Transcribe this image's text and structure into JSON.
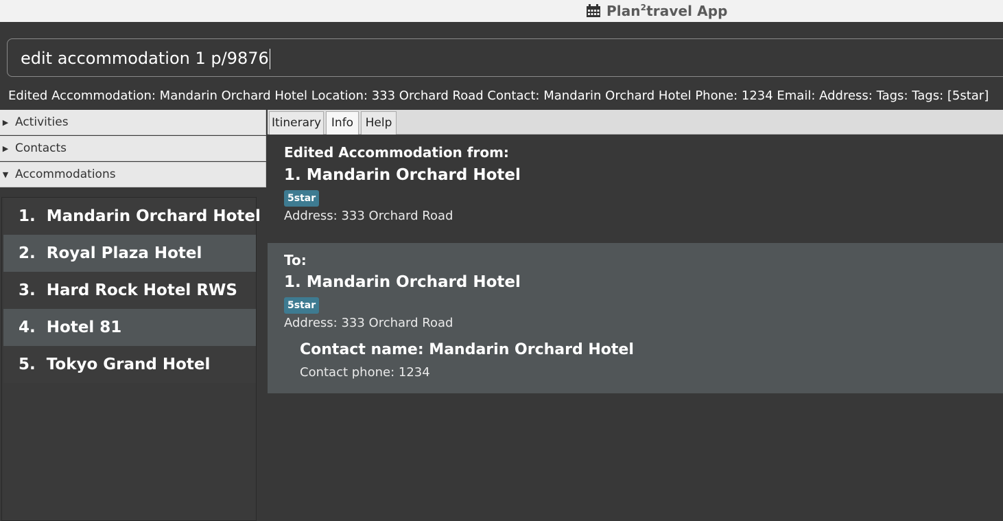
{
  "window": {
    "title_prefix": "Plan",
    "title_sup": "2",
    "title_suffix": "travel App"
  },
  "command": {
    "input_value": "edit accommodation 1 p/9876"
  },
  "result": {
    "text": "Edited Accommodation: Mandarin Orchard Hotel Location: 333 Orchard Road Contact: Mandarin Orchard Hotel Phone: 1234 Email:  Address:  Tags:  Tags: [5star]"
  },
  "sidebar": {
    "sections": [
      {
        "label": "Activities",
        "expanded": false
      },
      {
        "label": "Contacts",
        "expanded": false
      },
      {
        "label": "Accommodations",
        "expanded": true
      }
    ],
    "accommodations": [
      "1.  Mandarin Orchard Hotel",
      "2.  Royal Plaza Hotel",
      "3.  Hard Rock Hotel RWS",
      "4.  Hotel 81",
      "5.  Tokyo Grand Hotel"
    ]
  },
  "tabs": {
    "items": [
      "Itinerary",
      "Info",
      "Help"
    ],
    "active": "Info"
  },
  "info": {
    "from_header": "Edited Accommodation from:",
    "from_name": "1.  Mandarin Orchard Hotel",
    "from_tag": "5star",
    "from_address": "Address: 333 Orchard Road",
    "to_header": "To:",
    "to_name": "1.  Mandarin Orchard Hotel",
    "to_tag": "5star",
    "to_address": "Address: 333 Orchard Road",
    "contact_name": "Contact name: Mandarin Orchard Hotel",
    "contact_phone": "Contact phone: 1234"
  },
  "colors": {
    "background": "#383838",
    "list_alt_row": "#515658",
    "tag": "#3e7b91"
  },
  "icons": {
    "title": "calendar-icon",
    "collapsed": "triangle-right-icon",
    "expanded": "triangle-down-icon"
  }
}
